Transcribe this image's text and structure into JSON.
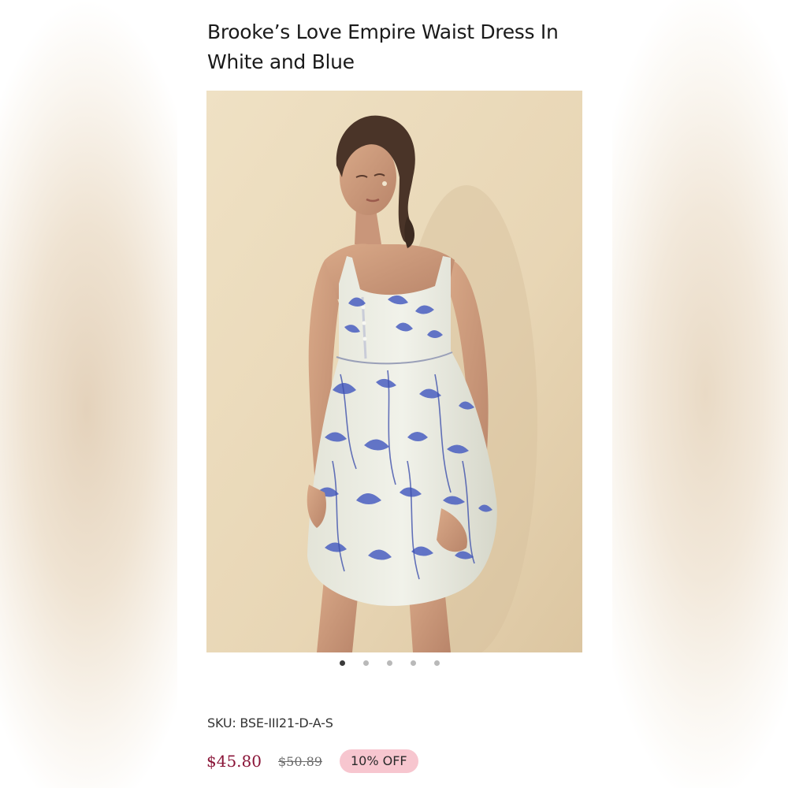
{
  "product": {
    "title": "Brooke’s Love Empire Waist Dress In White and Blue",
    "image_alt": "Model wearing a white and blue floral print empire waist dress",
    "gallery": {
      "total": 5,
      "active_index": 0
    },
    "sku": "SKU: BSE-III21-D-A-S",
    "price": "$45.80",
    "original_price": "$50.89",
    "discount_badge": "10% OFF"
  },
  "colors": {
    "price": "#8a1538",
    "badge_bg": "#f7c6cf",
    "dress_print": "#4a5fc1",
    "dress_base": "#eef0e6",
    "backdrop": "#e6d4b4"
  },
  "icons": {
    "gallery_dot": "dot-indicator"
  }
}
